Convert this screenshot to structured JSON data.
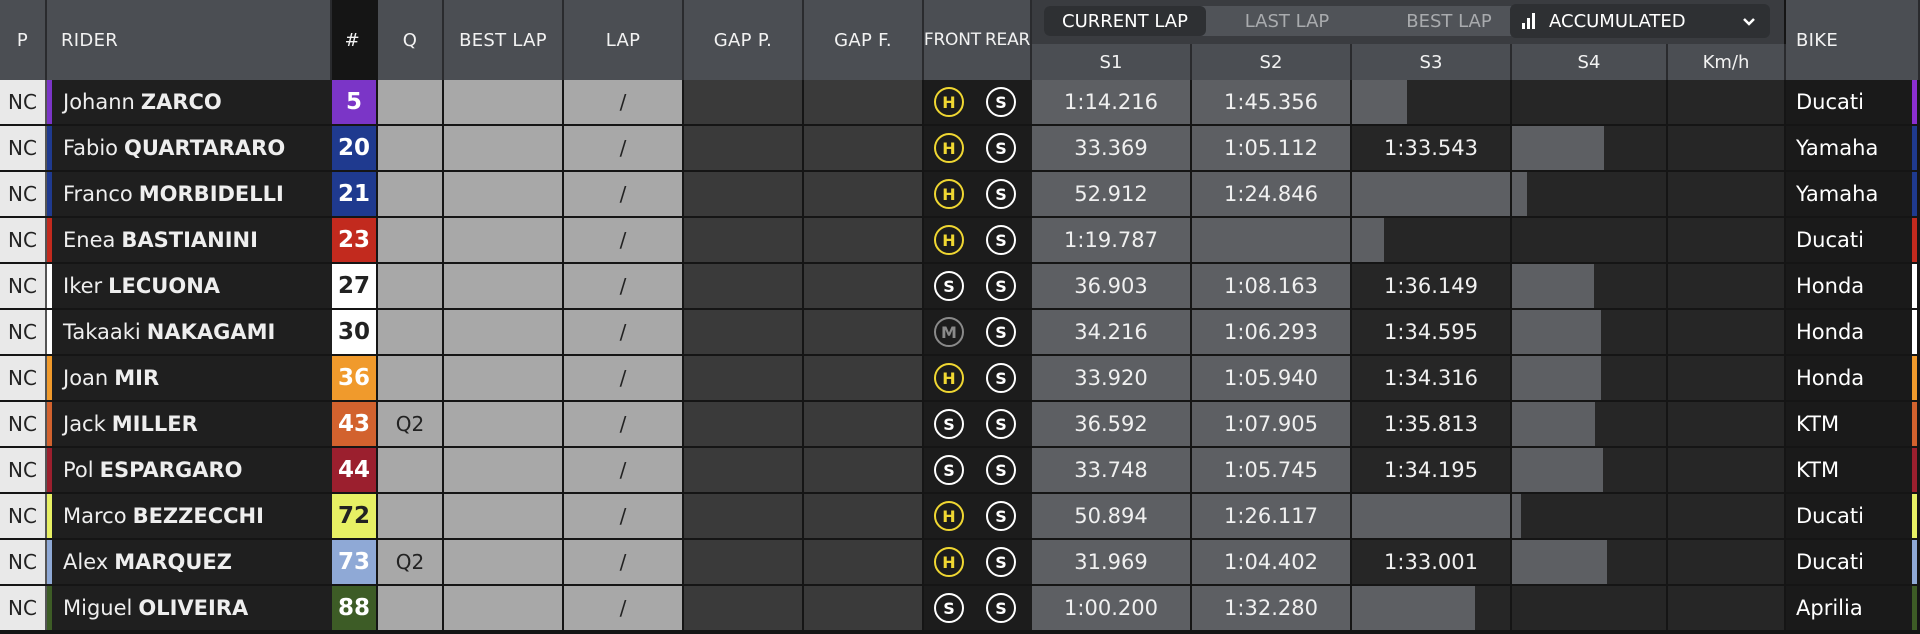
{
  "header": {
    "p": "P",
    "rider": "RIDER",
    "num": "#",
    "q": "Q",
    "best_lap": "BEST LAP",
    "lap": "LAP",
    "gap_p": "GAP P.",
    "gap_f": "GAP F.",
    "front": "FRONT",
    "rear": "REAR",
    "bike": "BIKE",
    "tabs": [
      "CURRENT LAP",
      "LAST LAP",
      "BEST LAP"
    ],
    "active_tab": 0,
    "dropdown_label": "ACCUMULATED",
    "sectors": [
      "S1",
      "S2",
      "S3",
      "S4",
      "Km/h"
    ]
  },
  "rows": [
    {
      "pos": "NC",
      "first": "Johann",
      "last": "ZARCO",
      "num": "5",
      "color": "#7b35c7",
      "q": "",
      "lap": "/",
      "front": "H",
      "rear": "S",
      "s1": "1:14.216",
      "s2": "1:45.356",
      "s3": "",
      "s4": "",
      "s3_fill": 0.35,
      "s4_fill": 0,
      "bike": "Ducati",
      "bike_color": "#8b2fd0"
    },
    {
      "pos": "NC",
      "first": "Fabio",
      "last": "QUARTARARO",
      "num": "20",
      "color": "#1f3a8f",
      "q": "",
      "lap": "/",
      "front": "H",
      "rear": "S",
      "s1": "33.369",
      "s2": "1:05.112",
      "s3": "1:33.543",
      "s4": "",
      "s3_fill": 0,
      "s4_fill": 0.6,
      "bike": "Yamaha",
      "bike_color": "#1f3a8f"
    },
    {
      "pos": "NC",
      "first": "Franco",
      "last": "MORBIDELLI",
      "num": "21",
      "color": "#1f3a8f",
      "q": "",
      "lap": "/",
      "front": "H",
      "rear": "S",
      "s1": "52.912",
      "s2": "1:24.846",
      "s3": "",
      "s4": "",
      "s3_fill": 1.0,
      "s4_fill": 0.1,
      "bike": "Yamaha",
      "bike_color": "#1f3a8f"
    },
    {
      "pos": "NC",
      "first": "Enea",
      "last": "BASTIANINI",
      "num": "23",
      "color": "#c22a1e",
      "q": "",
      "lap": "/",
      "front": "H",
      "rear": "S",
      "s1": "1:19.787",
      "s2": "",
      "s3": "",
      "s4": "",
      "s2_fill": 1.0,
      "s3_fill": 0.2,
      "s4_fill": 0,
      "bike": "Ducati",
      "bike_color": "#c22a1e"
    },
    {
      "pos": "NC",
      "first": "Iker",
      "last": "LECUONA",
      "num": "27",
      "color": "#ffffff",
      "q": "",
      "lap": "/",
      "front": "S",
      "rear": "S",
      "s1": "36.903",
      "s2": "1:08.163",
      "s3": "1:36.149",
      "s4": "",
      "s3_fill": 0,
      "s4_fill": 0.53,
      "bike": "Honda",
      "bike_color": "#ffffff"
    },
    {
      "pos": "NC",
      "first": "Takaaki",
      "last": "NAKAGAMI",
      "num": "30",
      "color": "#ffffff",
      "q": "",
      "lap": "/",
      "front": "M",
      "rear": "S",
      "s1": "34.216",
      "s2": "1:06.293",
      "s3": "1:34.595",
      "s4": "",
      "s3_fill": 0,
      "s4_fill": 0.58,
      "bike": "Honda",
      "bike_color": "#ffffff"
    },
    {
      "pos": "NC",
      "first": "Joan",
      "last": "MIR",
      "num": "36",
      "color": "#f09a2c",
      "q": "",
      "lap": "/",
      "front": "H",
      "rear": "S",
      "s1": "33.920",
      "s2": "1:05.940",
      "s3": "1:34.316",
      "s4": "",
      "s3_fill": 0,
      "s4_fill": 0.58,
      "bike": "Honda",
      "bike_color": "#f09a2c"
    },
    {
      "pos": "NC",
      "first": "Jack",
      "last": "MILLER",
      "num": "43",
      "color": "#d2622e",
      "q": "Q2",
      "lap": "/",
      "front": "S",
      "rear": "S",
      "s1": "36.592",
      "s2": "1:07.905",
      "s3": "1:35.813",
      "s4": "",
      "s3_fill": 0,
      "s4_fill": 0.54,
      "bike": "KTM",
      "bike_color": "#d2622e"
    },
    {
      "pos": "NC",
      "first": "Pol",
      "last": "ESPARGARO",
      "num": "44",
      "color": "#9b1f2e",
      "q": "",
      "lap": "/",
      "front": "S",
      "rear": "S",
      "s1": "33.748",
      "s2": "1:05.745",
      "s3": "1:34.195",
      "s4": "",
      "s3_fill": 0,
      "s4_fill": 0.59,
      "bike": "KTM",
      "bike_color": "#9b1f2e"
    },
    {
      "pos": "NC",
      "first": "Marco",
      "last": "BEZZECCHI",
      "num": "72",
      "color": "#e7f064",
      "q": "",
      "lap": "/",
      "front": "H",
      "rear": "S",
      "s1": "50.894",
      "s2": "1:26.117",
      "s3": "",
      "s4": "",
      "s3_fill": 1.0,
      "s4_fill": 0.06,
      "bike": "Ducati",
      "bike_color": "#e7f064"
    },
    {
      "pos": "NC",
      "first": "Alex",
      "last": "MARQUEZ",
      "num": "73",
      "color": "#8fa9d6",
      "q": "Q2",
      "lap": "/",
      "front": "H",
      "rear": "S",
      "s1": "31.969",
      "s2": "1:04.402",
      "s3": "1:33.001",
      "s4": "",
      "s3_fill": 0,
      "s4_fill": 0.62,
      "bike": "Ducati",
      "bike_color": "#8fa9d6"
    },
    {
      "pos": "NC",
      "first": "Miguel",
      "last": "OLIVEIRA",
      "num": "88",
      "color": "#3d5c26",
      "q": "",
      "lap": "/",
      "front": "S",
      "rear": "S",
      "s1": "1:00.200",
      "s2": "1:32.280",
      "s3": "",
      "s4": "",
      "s3_fill": 0.78,
      "s4_fill": 0,
      "bike": "Aprilia",
      "bike_color": "#3d5c26"
    }
  ]
}
